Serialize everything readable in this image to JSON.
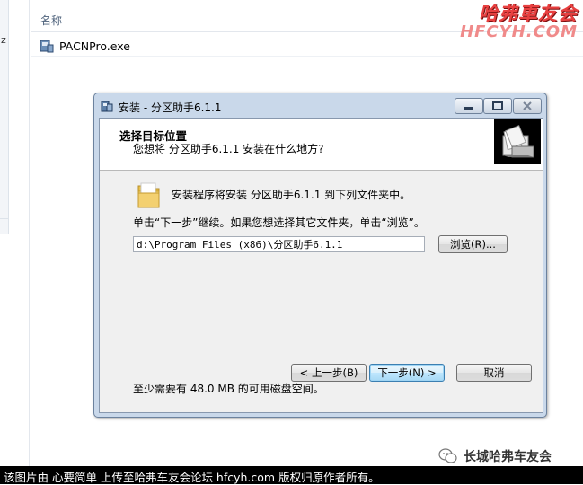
{
  "explorer": {
    "column_header": "名称",
    "file_name": "PACNPro.exe",
    "left_fragment": "z"
  },
  "watermark": {
    "line1": "哈弗車友会",
    "line2": "HFCYH.COM"
  },
  "dialog": {
    "title": "安装 - 分区助手6.1.1",
    "header_title": "选择目标位置",
    "header_subtitle": "您想将 分区助手6.1.1 安装在什么地方?",
    "install_text": "安装程序将安装 分区助手6.1.1 到下列文件夹中。",
    "click_text": "单击“下一步”继续。如果您想选择其它文件夹，单击“浏览”。",
    "path_value": "d:\\Program Files (x86)\\分区助手6.1.1",
    "browse_label": "浏览(R)...",
    "space_text": "至少需要有 48.0 MB 的可用磁盘空间。",
    "back_label": "< 上一步(B)",
    "next_label": "下一步(N) >",
    "cancel_label": "取消"
  },
  "wechat_label": "长城哈弗车友会",
  "caption": "该图片由 心要简单 上传至哈弗车友会论坛 hfcyh.com 版权归原作者所有。"
}
